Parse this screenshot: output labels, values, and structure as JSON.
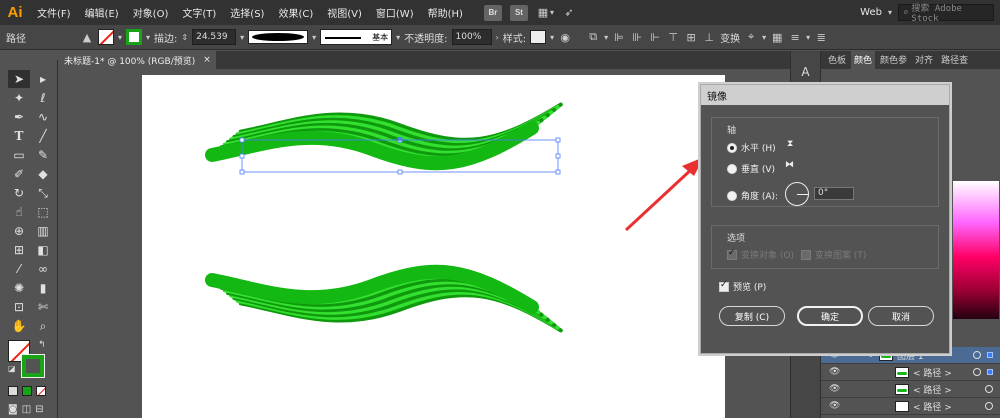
{
  "app": {
    "logo": "Ai",
    "workspace": "Web",
    "search_placeholder": "搜索 Adobe Stock"
  },
  "menu": [
    "文件(F)",
    "编辑(E)",
    "对象(O)",
    "文字(T)",
    "选择(S)",
    "效果(C)",
    "视图(V)",
    "窗口(W)",
    "帮助(H)"
  ],
  "menu_badges": [
    "Br",
    "St"
  ],
  "control": {
    "object_type": "路径",
    "stroke_label": "描边:",
    "stroke_value": "24.539",
    "stroke_style": "基本",
    "opacity_label": "不透明度:",
    "opacity_value": "100%",
    "style_label": "样式:",
    "transform_label": "变换"
  },
  "document_tab": {
    "title": "未标题-1* @ 100% (RGB/预览)",
    "close": "×"
  },
  "right_panel": {
    "tabs": [
      "色板",
      "颜色",
      "颜色参",
      "对齐",
      "路径查"
    ],
    "active_tab": "颜色",
    "layers": [
      {
        "label": "图层 1",
        "expanded": true
      },
      {
        "label": "< 路径 >"
      },
      {
        "label": "< 路径 >"
      },
      {
        "label": "< 路径 >"
      }
    ]
  },
  "dialog": {
    "title": "镜像",
    "axis_label": "轴",
    "horizontal_label": "水平 (H)",
    "vertical_label": "垂直 (V)",
    "angle_label": "角度 (A):",
    "angle_value": "0°",
    "options_label": "选项",
    "transform_objects_label": "变换对象 (O)",
    "transform_patterns_label": "变换图案 (T)",
    "preview_label": "预览 (P)",
    "copy_button": "复制 (C)",
    "ok_button": "确定",
    "cancel_button": "取消",
    "selected_axis": "horizontal",
    "preview_checked": true
  },
  "colors": {
    "accent_green": "#19a319",
    "wave_green": "#21d01e",
    "arrow_red": "#e83030",
    "layer_select": "#4b6b95"
  },
  "tools": [
    "selection-tool",
    "direct-selection-tool",
    "magic-wand-tool",
    "lasso-tool",
    "pen-tool",
    "curvature-tool",
    "type-tool",
    "line-tool",
    "rectangle-tool",
    "paintbrush-tool",
    "shaper-tool",
    "eraser-tool",
    "rotate-tool",
    "scale-tool",
    "warp-tool",
    "free-transform-tool",
    "shape-builder-tool",
    "perspective-grid-tool",
    "mesh-tool",
    "gradient-tool",
    "eyedropper-tool",
    "blend-tool",
    "symbol-sprayer-tool",
    "column-graph-tool",
    "artboard-tool",
    "slice-tool",
    "hand-tool",
    "zoom-tool"
  ]
}
